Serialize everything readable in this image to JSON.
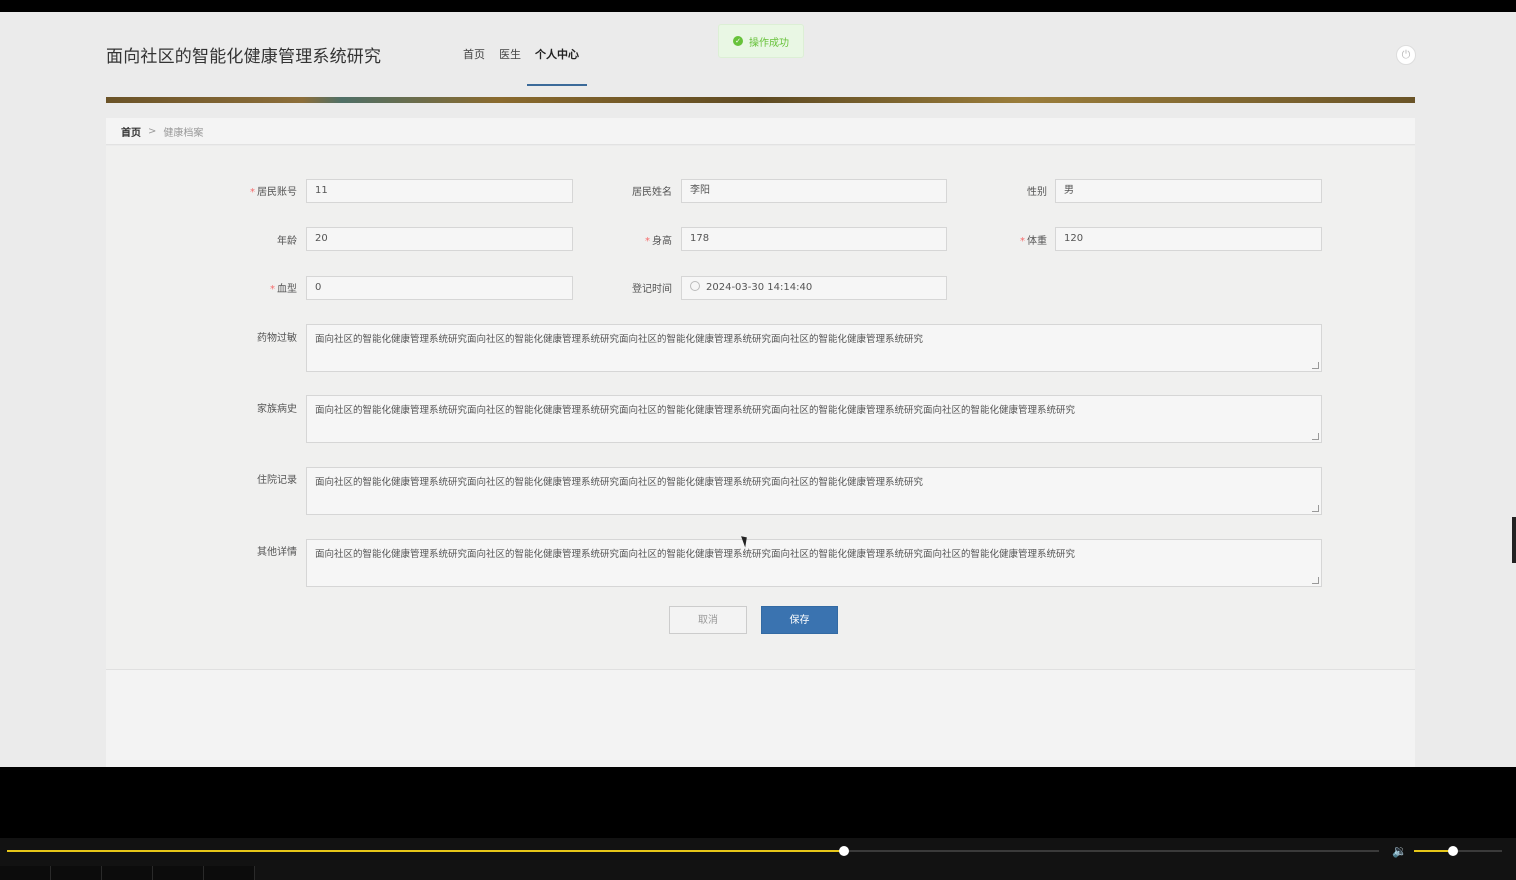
{
  "app": {
    "title": "面向社区的智能化健康管理系统研究"
  },
  "nav": [
    {
      "label": "首页"
    },
    {
      "label": "医生"
    },
    {
      "label": "个人中心"
    }
  ],
  "toast": {
    "message": "操作成功"
  },
  "breadcrumb": {
    "home": "首页",
    "separator": ">",
    "current": "健康档案"
  },
  "form": {
    "account": {
      "label": "居民账号",
      "value": "11",
      "required": true
    },
    "name": {
      "label": "居民姓名",
      "value": "李阳",
      "required": false
    },
    "gender": {
      "label": "性别",
      "value": "男",
      "required": false
    },
    "age": {
      "label": "年龄",
      "value": "20",
      "required": false
    },
    "height": {
      "label": "身高",
      "value": "178",
      "required": true
    },
    "weight": {
      "label": "体重",
      "value": "120",
      "required": true
    },
    "blood": {
      "label": "血型",
      "value": "0",
      "required": true
    },
    "regtime": {
      "label": "登记时间",
      "value": "2024-03-30 14:14:40",
      "required": false
    },
    "allergy": {
      "label": "药物过敏",
      "value": "面向社区的智能化健康管理系统研究面向社区的智能化健康管理系统研究面向社区的智能化健康管理系统研究面向社区的智能化健康管理系统研究"
    },
    "family": {
      "label": "家族病史",
      "value": "面向社区的智能化健康管理系统研究面向社区的智能化健康管理系统研究面向社区的智能化健康管理系统研究面向社区的智能化健康管理系统研究面向社区的智能化健康管理系统研究"
    },
    "hospital": {
      "label": "住院记录",
      "value": "面向社区的智能化健康管理系统研究面向社区的智能化健康管理系统研究面向社区的智能化健康管理系统研究面向社区的智能化健康管理系统研究"
    },
    "other": {
      "label": "其他详情",
      "value": "面向社区的智能化健康管理系统研究面向社区的智能化健康管理系统研究面向社区的智能化健康管理系统研究面向社区的智能化健康管理系统研究面向社区的智能化健康管理系统研究"
    }
  },
  "buttons": {
    "cancel": "取消",
    "save": "保存"
  },
  "player": {
    "progress": 0.61,
    "volume": 0.44
  },
  "colors": {
    "primary": "#3a73b0",
    "required": "#f56c6c",
    "success": "#67c23a",
    "progress": "#e6c619"
  },
  "icons": {
    "toast": "check-circle-icon",
    "power": "power-icon",
    "clock": "clock-icon",
    "volume": "speaker-icon"
  }
}
